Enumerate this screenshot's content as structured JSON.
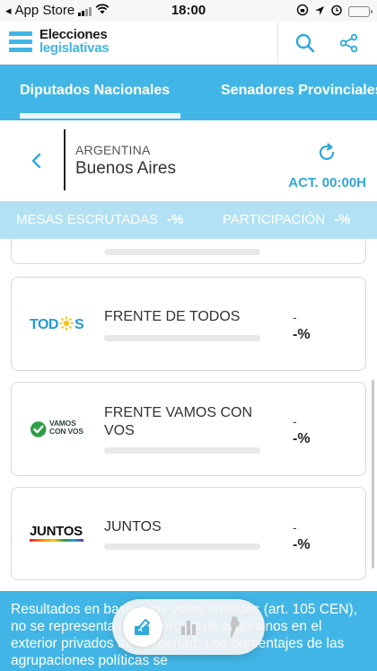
{
  "status_bar": {
    "carrier": "App Store",
    "time": "18:00"
  },
  "header": {
    "logo_line1": "Elecciones",
    "logo_line2": "legislativas"
  },
  "tabs": [
    {
      "label": "Diputados Nacionales",
      "active": true
    },
    {
      "label": "Senadores Provinciales",
      "active": false
    }
  ],
  "location": {
    "country": "ARGENTINA",
    "region": "Buenos Aires",
    "update_label": "ACT. 00:00H"
  },
  "stats": {
    "mesas_label": "MESAS ESCRUTADAS",
    "mesas_value": "-%",
    "participacion_label": "PARTICIPACIÓN",
    "participacion_value": "-%"
  },
  "parties": [
    {
      "logo_text": "TODOS",
      "name": "FRENTE DE TODOS",
      "votes": "-",
      "percent": "-%"
    },
    {
      "logo_text_1": "VAMOS",
      "logo_text_2": "CON VOS",
      "name": "FRENTE VAMOS CON VOS",
      "votes": "-",
      "percent": "-%"
    },
    {
      "logo_text": "JUNTOS",
      "name": "JUNTOS",
      "votes": "-",
      "percent": "-%"
    }
  ],
  "footer": {
    "text": "Resultados en base a los votos emitidos (art. 105 CEN), no se representa la proporción de argentinos en el exterior privados de la libertad. Los porcentajes de las agrupaciones políticas se"
  },
  "colors": {
    "brand_blue": "#41b6e6",
    "stats_bg": "#b3e1f4",
    "accent_text": "#2fa8dc",
    "vamos_green": "#2e9e47"
  }
}
